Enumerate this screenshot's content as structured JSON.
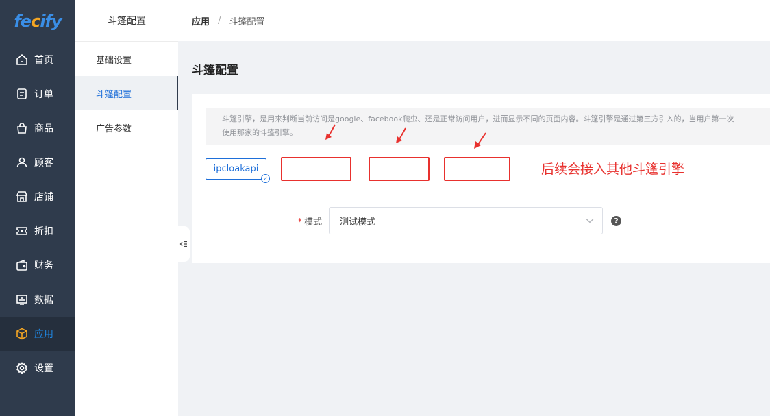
{
  "brand": {
    "logo_pre": "fe",
    "logo_accent": "c",
    "logo_post": "ify"
  },
  "nav": {
    "items": [
      {
        "label": "首页",
        "icon": "home-icon"
      },
      {
        "label": "订单",
        "icon": "order-icon"
      },
      {
        "label": "商品",
        "icon": "bag-icon"
      },
      {
        "label": "顾客",
        "icon": "user-icon"
      },
      {
        "label": "店铺",
        "icon": "store-icon"
      },
      {
        "label": "折扣",
        "icon": "ticket-icon"
      },
      {
        "label": "财务",
        "icon": "wallet-icon"
      },
      {
        "label": "数据",
        "icon": "chart-icon"
      },
      {
        "label": "应用",
        "icon": "cube-icon",
        "active": true
      },
      {
        "label": "设置",
        "icon": "gear-icon"
      }
    ]
  },
  "subnav": {
    "title": "斗篷配置",
    "items": [
      {
        "label": "基础设置"
      },
      {
        "label": "斗篷配置",
        "active": true
      },
      {
        "label": "广告参数"
      }
    ]
  },
  "breadcrumb": {
    "parent": "应用",
    "separator": "/",
    "current": "斗篷配置"
  },
  "page": {
    "title": "斗篷配置",
    "notice_line1": "斗篷引擎，是用来判断当前访问是google、facebook爬虫、还是正常访问用户，进而显示不同的页面内容。斗篷引擎是通过第三方引入的，当用户第一次",
    "notice_line2": "使用那家的斗篷引擎。",
    "engine_option": "ipcloakapi",
    "annotation": "后续会接入其他斗篷引擎",
    "mode_required_mark": "*",
    "mode_label": "模式",
    "mode_value": "测试模式",
    "help_glyph": "?"
  },
  "colors": {
    "nav_bg": "#2f3b4c",
    "accent": "#1e88e5",
    "annotation": "#e8312e"
  }
}
